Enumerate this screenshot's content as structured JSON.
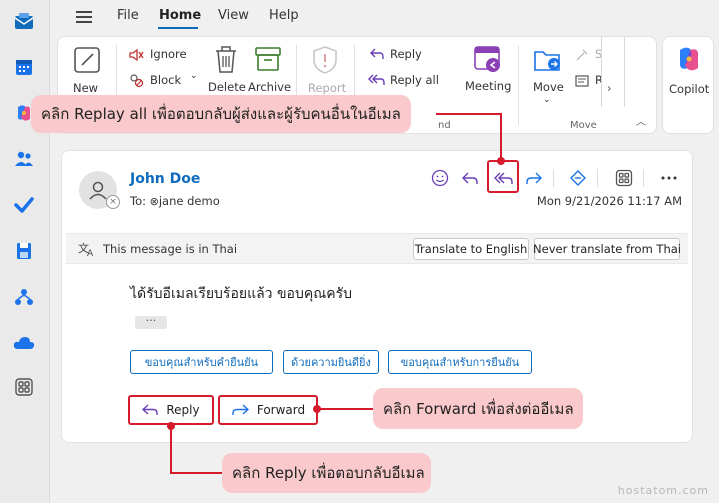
{
  "menu": {
    "tabs": [
      {
        "label": "File"
      },
      {
        "label": "Home"
      },
      {
        "label": "View"
      },
      {
        "label": "Help"
      }
    ],
    "active_tab": "Home"
  },
  "ribbon": {
    "new_label": "New",
    "ignore_label": "Ignore",
    "block_label": "Block",
    "delete_label": "Delete",
    "archive_label": "Archive",
    "report_label": "Report",
    "reply_label": "Reply",
    "reply_all_label": "Reply all",
    "meeting_label": "Meeting",
    "move_label": "Move",
    "move_group_label": "Move",
    "respond_group_label": "nd",
    "copilot_label": "Copilot",
    "partial_s": "S",
    "partial_r": "R"
  },
  "message": {
    "sender": "John Doe",
    "to_prefix": "To:",
    "to_name": "jane demo",
    "date": "Mon 9/21/2026 11:17 AM",
    "translate_notice": "This message is in Thai",
    "translate_button": "Translate to English",
    "never_translate_button": "Never translate from Thai",
    "body": "ได้รับอีเมลเรียบร้อยแล้ว ขอบคุณครับ",
    "ellipsis": "···",
    "suggested_replies": [
      {
        "label": "ขอบคุณสำหรับคำยืนยัน"
      },
      {
        "label": "ด้วยความยินดียิ่ง"
      },
      {
        "label": "ขอบคุณสำหรับการยืนยัน"
      }
    ],
    "reply_button": "Reply",
    "forward_button": "Forward"
  },
  "annotations": {
    "reply_all": "คลิก Replay all เพื่อตอบกลับผู้ส่งและผู้รับคนอื่นในอีเมล",
    "forward": "คลิก Forward เพื่อส่งต่ออีเมล",
    "reply": "คลิก Reply เพื่อตอบกลับอีเมล"
  },
  "watermark": "hostatom.com",
  "colors": {
    "accent": "#0f6cbd",
    "highlight": "#d61b2b",
    "callout_bg": "#f9c9cc"
  }
}
